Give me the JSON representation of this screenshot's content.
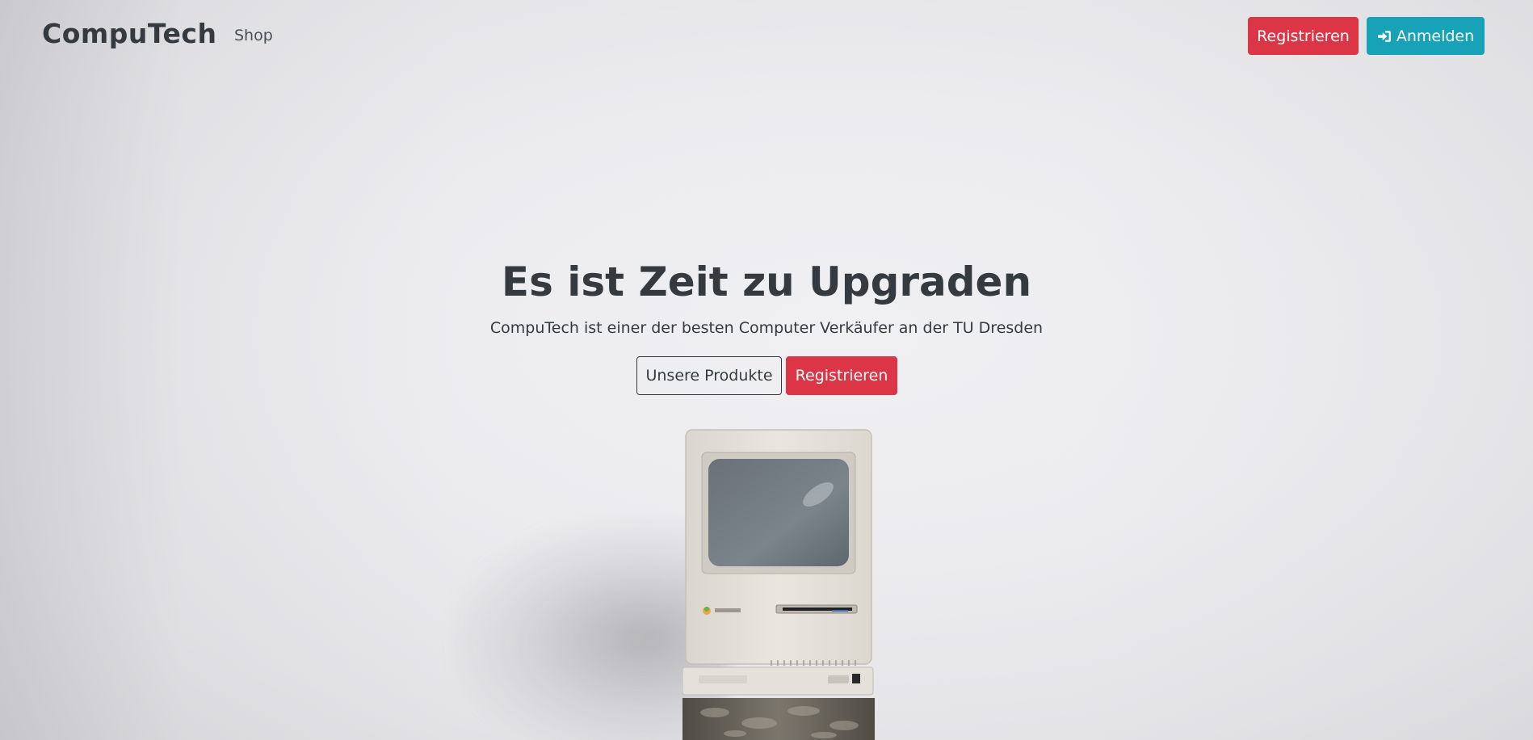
{
  "navbar": {
    "brand": "CompuTech",
    "links": [
      {
        "label": "Shop"
      }
    ],
    "register_label": "Registrieren",
    "login_label": "Anmelden",
    "colors": {
      "register": "#dc3545",
      "login": "#17a2b8"
    },
    "icons": {
      "login": "sign-in-icon"
    }
  },
  "hero": {
    "title": "Es ist Zeit zu Upgraden",
    "subtitle": "CompuTech ist einer der besten Computer Verkäufer an der TU Dresden",
    "products_button": "Unsere Produkte",
    "register_button": "Registrieren"
  }
}
